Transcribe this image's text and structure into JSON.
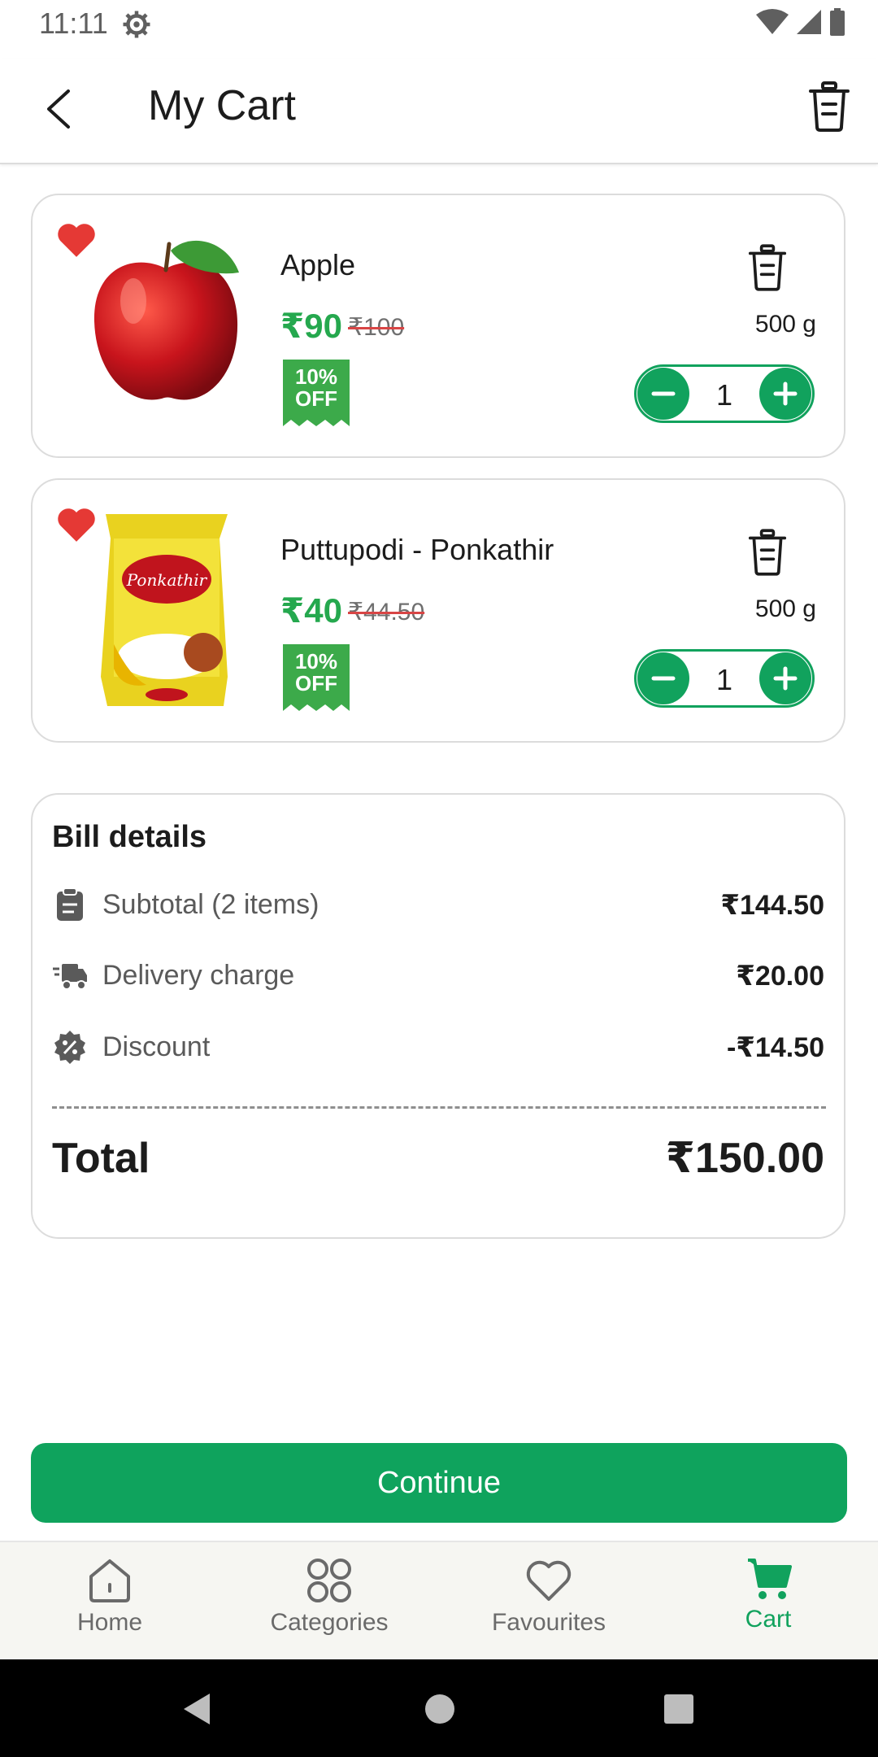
{
  "status_bar": {
    "time": "11:11"
  },
  "header": {
    "title": "My Cart"
  },
  "cart_items": [
    {
      "name": "Apple",
      "price": "₹90",
      "mrp": "₹100",
      "discount_line1": "10%",
      "discount_line2": "OFF",
      "weight": "500 g",
      "quantity": "1"
    },
    {
      "name": "Puttupodi - Ponkathir",
      "price": "₹40",
      "mrp": "₹44.50",
      "discount_line1": "10%",
      "discount_line2": "OFF",
      "weight": "500 g",
      "quantity": "1",
      "brand_on_pack": "Ponkathir"
    }
  ],
  "bill": {
    "title": "Bill details",
    "subtotal_label": "Subtotal (2 items)",
    "subtotal_value": "₹144.50",
    "delivery_label": "Delivery charge",
    "delivery_value": "₹20.00",
    "discount_label": "Discount",
    "discount_value": "-₹14.50",
    "total_label": "Total",
    "total_value": "₹150.00"
  },
  "continue_label": "Continue",
  "bottom_nav": [
    {
      "label": "Home",
      "icon": "home-icon"
    },
    {
      "label": "Categories",
      "icon": "grid-icon"
    },
    {
      "label": "Favourites",
      "icon": "heart-icon"
    },
    {
      "label": "Cart",
      "icon": "cart-icon",
      "active": true
    }
  ],
  "colors": {
    "accent": "#11a25d",
    "price": "#25a84e",
    "favorite": "#e53935"
  }
}
